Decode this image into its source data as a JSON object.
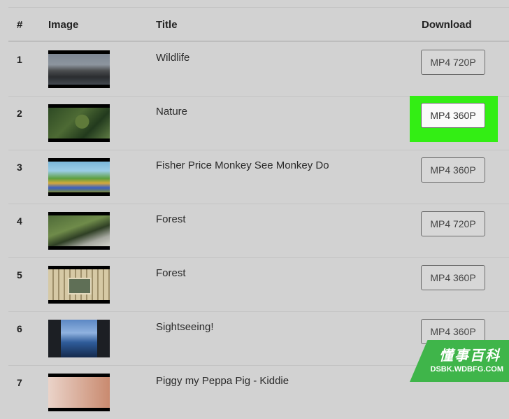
{
  "table": {
    "headers": {
      "num": "#",
      "image": "Image",
      "title": "Title",
      "download": "Download"
    },
    "rows": [
      {
        "num": "1",
        "title": "Wildlife",
        "download": "MP4 720P"
      },
      {
        "num": "2",
        "title": "Nature",
        "download": "MP4 360P"
      },
      {
        "num": "3",
        "title": "Fisher Price Monkey See Monkey Do",
        "download": "MP4 360P"
      },
      {
        "num": "4",
        "title": "Forest",
        "download": "MP4 720P"
      },
      {
        "num": "5",
        "title": "Forest",
        "download": "MP4 360P"
      },
      {
        "num": "6",
        "title": "Sightseeing!",
        "download": "MP4 360P"
      },
      {
        "num": "7",
        "title": "Piggy my Peppa Pig - Kiddie",
        "download": ""
      }
    ]
  },
  "watermark": {
    "chinese": "懂事百科",
    "url": "DSBK.WDBFG.COM"
  },
  "colors": {
    "highlight": "#33ee14",
    "watermark_bg": "#3fb54a"
  }
}
